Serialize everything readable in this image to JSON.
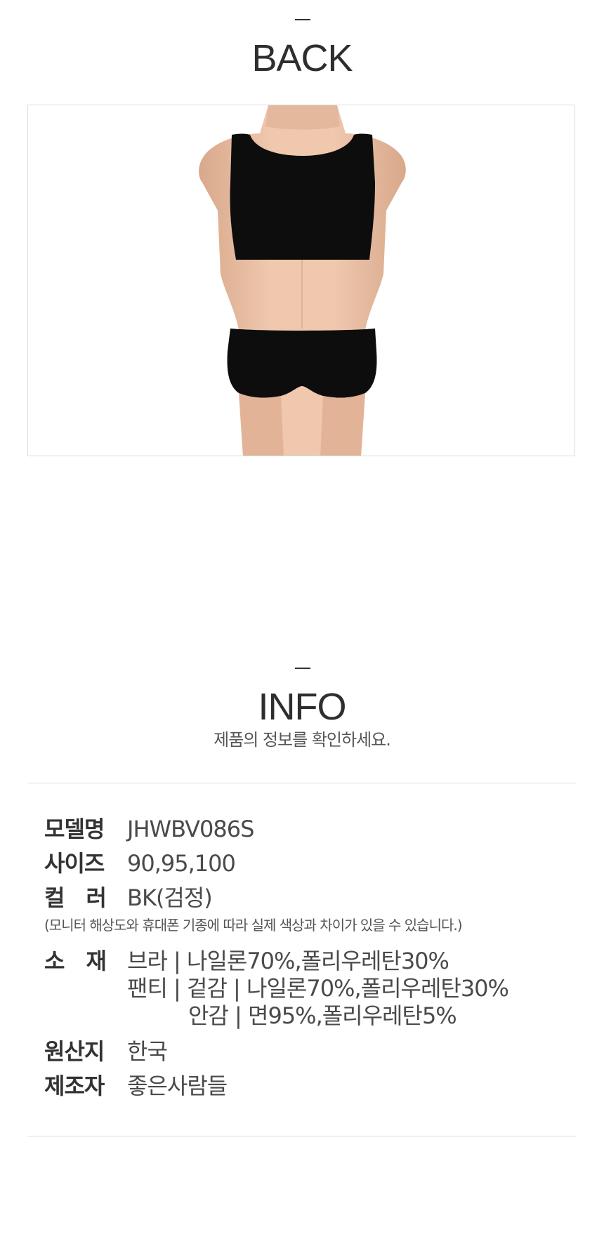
{
  "back": {
    "title": "BACK"
  },
  "info": {
    "title": "INFO",
    "subtitle": "제품의 정보를 확인하세요."
  },
  "specs": {
    "model": {
      "label": "모델명",
      "value": "JHWBV086S"
    },
    "size": {
      "label": "사이즈",
      "value": "90,95,100"
    },
    "color": {
      "label": "컬　러",
      "value": "BK(검정)"
    },
    "color_note": "(모니터 해상도와 휴대폰 기종에 따라 실제 색상과 차이가 있을 수 있습니다.)",
    "material": {
      "label": "소　재",
      "line1": "브라 | 나일론70%,폴리우레탄30%",
      "line2": "팬티 | 겉감 | 나일론70%,폴리우레탄30%",
      "line3": "안감 | 면95%,폴리우레탄5%"
    },
    "origin": {
      "label": "원산지",
      "value": "한국"
    },
    "maker": {
      "label": "제조자",
      "value": "좋은사람들"
    }
  },
  "colors": {
    "garment": "#0d0d0d",
    "skin": "#e9c2a8",
    "divider": "#dedede"
  }
}
